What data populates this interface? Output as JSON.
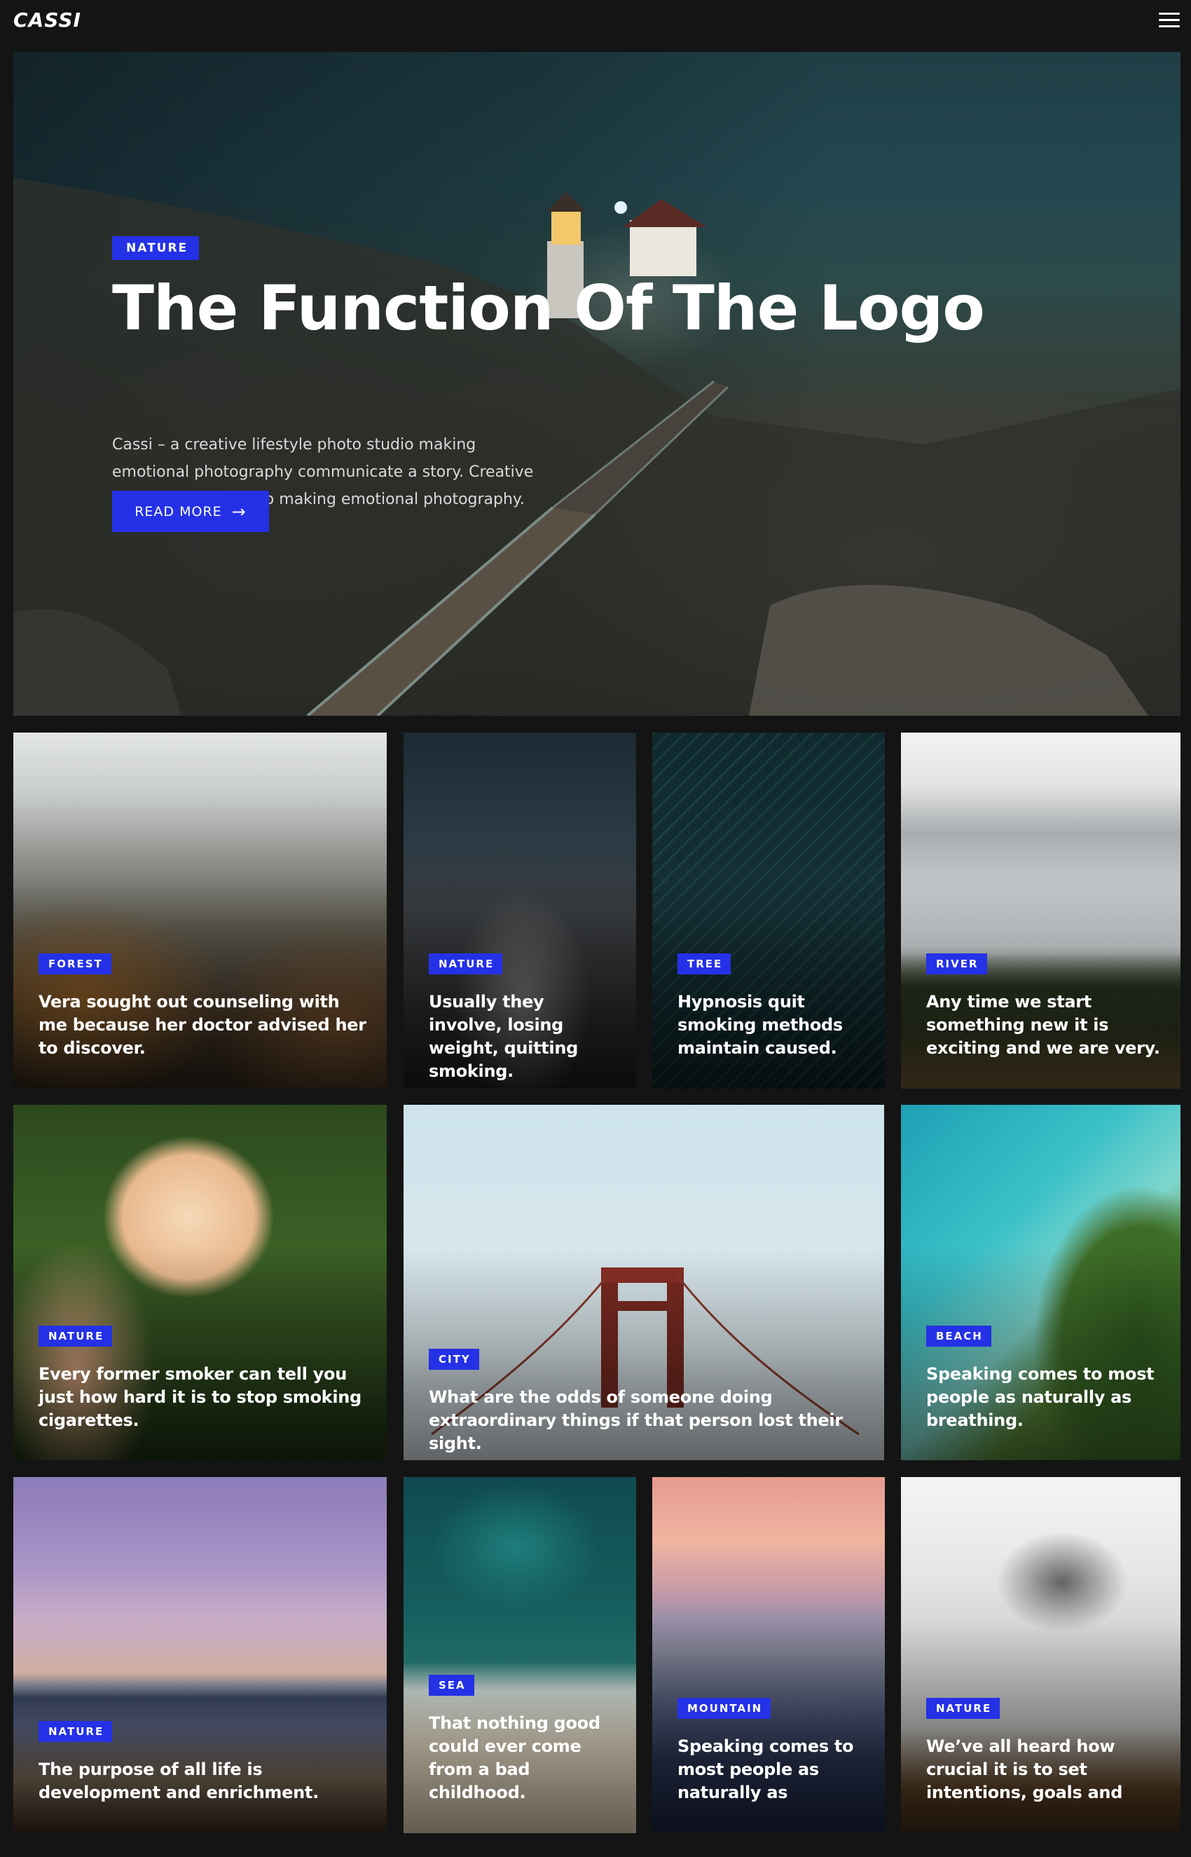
{
  "header": {
    "logo": "CASSI",
    "menu_icon": "hamburger-menu-icon"
  },
  "hero": {
    "tag": "NATURE",
    "title": "The Function Of The Logo",
    "description": "Cassi – a creative lifestyle photo studio making emotional photography communicate a story. Creative lifestyle photo studio making emotional photography.",
    "button_label": "READ MORE",
    "button_icon": "arrow-right-icon"
  },
  "colors": {
    "accent": "#2431e6",
    "background": "#141414",
    "text": "#ffffff"
  },
  "cards": [
    {
      "tag": "FOREST",
      "title": "Vera sought out counseling with me because her doctor advised her to discover."
    },
    {
      "tag": "NATURE",
      "title": "Usually they involve, losing weight, quitting smoking."
    },
    {
      "tag": "TREE",
      "title": "Hypnosis quit smoking methods maintain caused."
    },
    {
      "tag": "RIVER",
      "title": "Any time we start something new it is exciting and we are very."
    },
    {
      "tag": "NATURE",
      "title": "Every former smoker can tell you just how hard it is to stop smoking cigarettes."
    },
    {
      "tag": "CITY",
      "title": "What are the odds of someone doing extraordinary things if that person lost their sight."
    },
    {
      "tag": "BEACH",
      "title": "Speaking comes to most people as naturally as breathing."
    },
    {
      "tag": "NATURE",
      "title": "The purpose of all life is development and enrichment."
    },
    {
      "tag": "SEA",
      "title": "That nothing good could ever come from a bad childhood."
    },
    {
      "tag": "MOUNTAIN",
      "title": "Speaking comes to most people as naturally as"
    },
    {
      "tag": "NATURE",
      "title": "We’ve all heard how crucial it is to set intentions, goals and"
    }
  ]
}
